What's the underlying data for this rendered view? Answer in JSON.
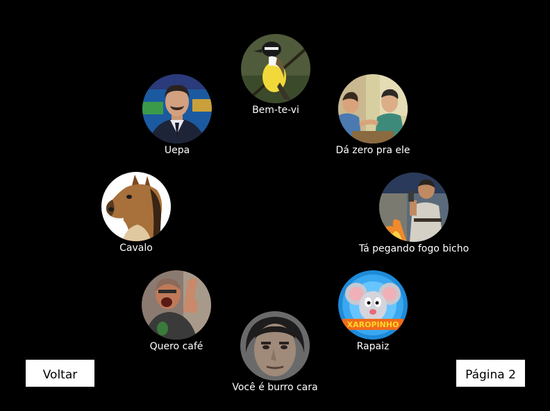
{
  "sounds": [
    {
      "label": "Bem-te-vi",
      "icon": "bird-icon"
    },
    {
      "label": "Uepa",
      "icon": "man-suit-icon"
    },
    {
      "label": "Dá zero pra ele",
      "icon": "two-men-icon"
    },
    {
      "label": "Cavalo",
      "icon": "horse-mask-icon"
    },
    {
      "label": "Tá pegando fogo bicho",
      "icon": "man-fire-icon"
    },
    {
      "label": "Quero café",
      "icon": "shouting-man-icon"
    },
    {
      "label": "Rapaiz",
      "icon": "cartoon-mouse-icon"
    },
    {
      "label": "Você é burro cara",
      "icon": "man-face-icon"
    }
  ],
  "thumb_caption_rapaiz": "XAROPINHO",
  "nav": {
    "back_label": "Voltar",
    "next_label": "Página 2"
  }
}
